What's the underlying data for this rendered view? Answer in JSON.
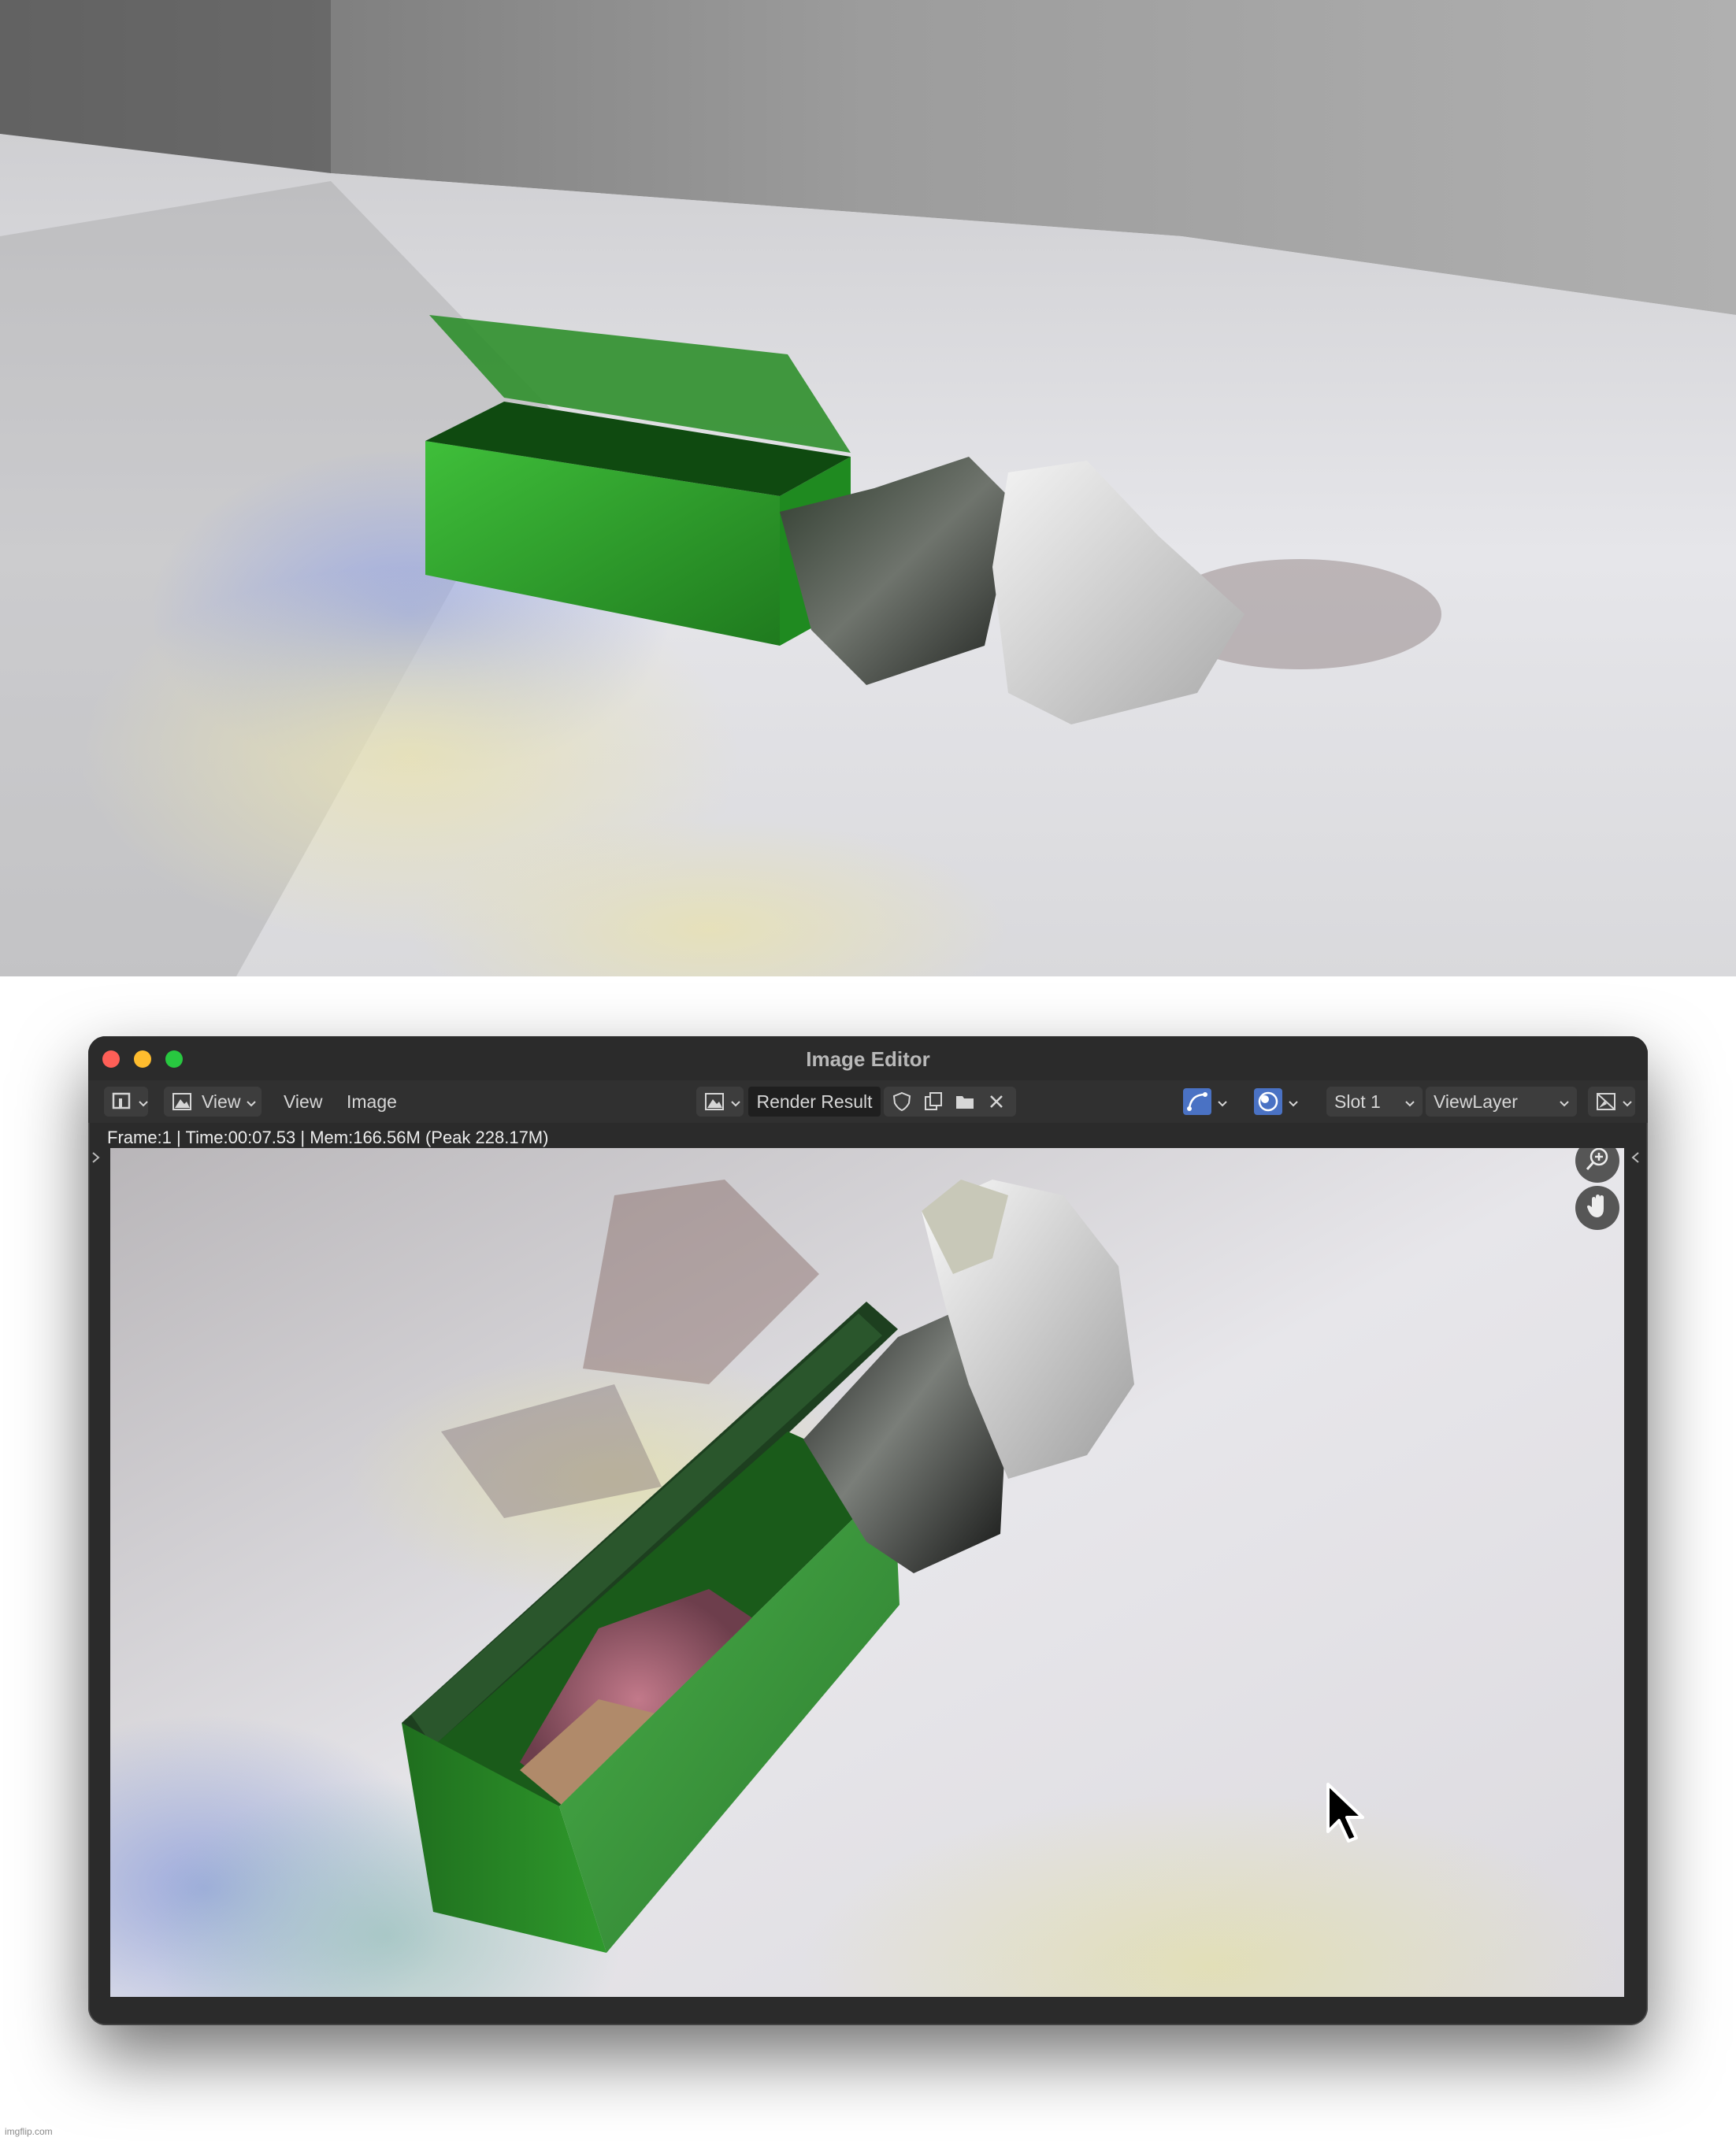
{
  "window": {
    "title": "Image Editor"
  },
  "header": {
    "editor_type_icon": "image-editor-icon",
    "mode_icon": "image-mode-icon",
    "view_label": "View",
    "menu_view": "View",
    "menu_image": "Image",
    "image_browse_icon": "image-browse-icon",
    "image_name": "Render Result",
    "fake_user_icon": "shield-icon",
    "new_image_icon": "duplicate-icon",
    "open_image_icon": "folder-icon",
    "unlink_icon": "close-icon",
    "sample_tool_icon": "curve-tool-icon",
    "display_channels_icon": "display-channels-icon",
    "slot_label": "Slot 1",
    "view_layer_label": "ViewLayer",
    "pass_icon": "render-pass-icon"
  },
  "status": {
    "text": "Frame:1 | Time:00:07.53 | Mem:166.56M (Peak 228.17M)"
  },
  "gizmos": {
    "zoom_icon": "zoom-icon",
    "pan_icon": "hand-icon"
  },
  "footer": {
    "watermark": "imgflip.com"
  },
  "colors": {
    "window_bg": "#2b2b2b",
    "header_bg": "#303030",
    "accent_blue": "#4a72c4",
    "box_green": "#2e9a2a",
    "close": "#ff5f57",
    "minimize": "#febc2e",
    "maximize": "#28c840"
  }
}
